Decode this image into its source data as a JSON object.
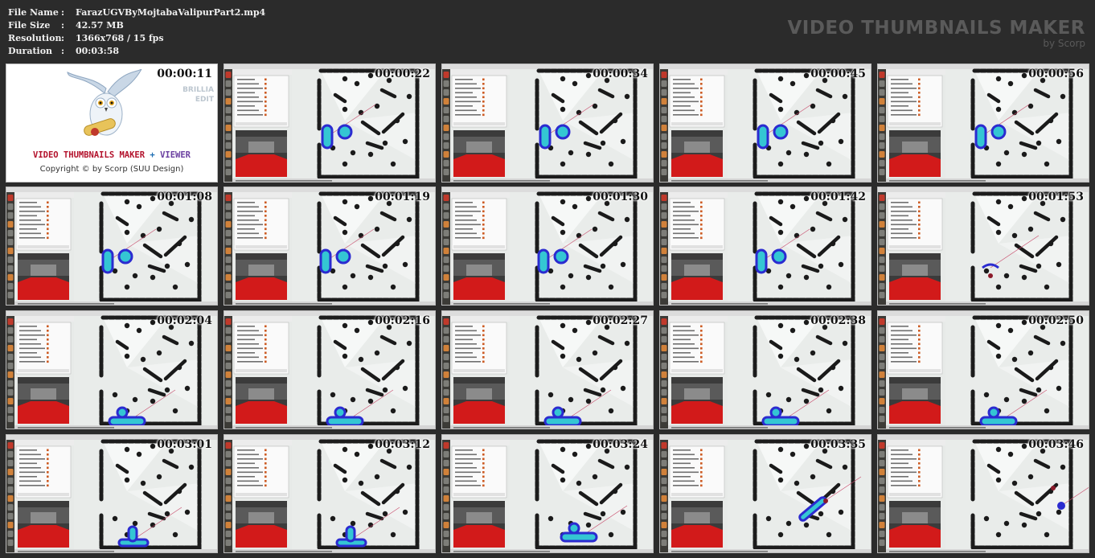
{
  "info": [
    {
      "key": "File Name",
      "value": "FarazUGVByMojtabaValipurPart2.mp4"
    },
    {
      "key": "File Size",
      "value": "42.57 MB"
    },
    {
      "key": "Resolution",
      "value": "1366x768 / 15 fps"
    },
    {
      "key": "Duration",
      "value": "00:03:58"
    }
  ],
  "brand": {
    "title": "VIDEO THUMBNAILS MAKER",
    "byline": "by Scorp"
  },
  "logo": {
    "timestamp": "00:00:11",
    "brilliant": "BRILLIA",
    "edit": "EDIT",
    "vtm": "VIDEO THUMBNAILS MAKER",
    "plus": "+",
    "viewer": "VIEWER",
    "copyright": "Copyright © by Scorp (SUU Design)"
  },
  "thumbnails": [
    {
      "time": "00:00:22",
      "variant": "a"
    },
    {
      "time": "00:00:34",
      "variant": "a"
    },
    {
      "time": "00:00:45",
      "variant": "a"
    },
    {
      "time": "00:00:56",
      "variant": "a"
    },
    {
      "time": "00:01:08",
      "variant": "b"
    },
    {
      "time": "00:01:19",
      "variant": "b"
    },
    {
      "time": "00:01:30",
      "variant": "b"
    },
    {
      "time": "00:01:42",
      "variant": "b"
    },
    {
      "time": "00:01:53",
      "variant": "c"
    },
    {
      "time": "00:02:04",
      "variant": "d"
    },
    {
      "time": "00:02:16",
      "variant": "d"
    },
    {
      "time": "00:02:27",
      "variant": "d"
    },
    {
      "time": "00:02:38",
      "variant": "d"
    },
    {
      "time": "00:02:50",
      "variant": "d"
    },
    {
      "time": "00:03:01",
      "variant": "e"
    },
    {
      "time": "00:03:12",
      "variant": "e"
    },
    {
      "time": "00:03:24",
      "variant": "f"
    },
    {
      "time": "00:03:35",
      "variant": "g"
    },
    {
      "time": "00:03:46",
      "variant": "h"
    }
  ],
  "colors": {
    "sidebar": "#3c3b37",
    "launcher_red": "#c0392b",
    "costmap_cyan": "#34c6d3",
    "costmap_blue": "#2b2bd0",
    "floor_red": "#d21a1a"
  }
}
